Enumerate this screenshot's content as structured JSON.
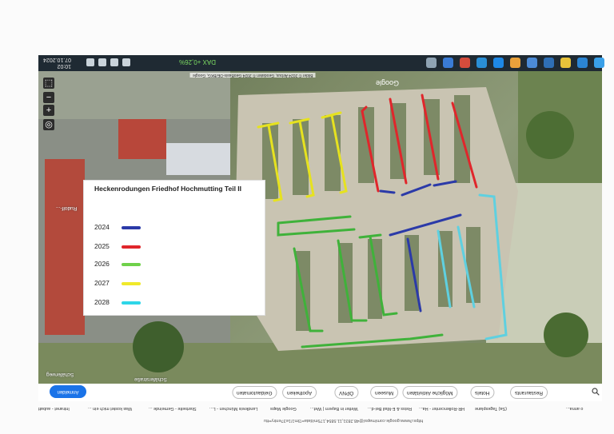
{
  "taskbar": {
    "time": "10:02",
    "date": "07.10.2024",
    "dax_label": "DAX",
    "dax_value": "+0,26%"
  },
  "map": {
    "google_mark": "Google",
    "attribution": "Bilder © 2024 Airbus, Geodaten © 2024 GeoBasis-DE/BKG, Google",
    "streets": {
      "top_left": "Schäferstraße",
      "bottom_left": "Schäferweg",
      "right": "Schaferstraße",
      "corner": "Rudolf-..."
    },
    "legend": {
      "title": "Heckenrodungen Friedhof Hochmutting Teil II",
      "items": [
        {
          "year": "2024",
          "color": "#2b3aa8"
        },
        {
          "year": "2025",
          "color": "#e0262b"
        },
        {
          "year": "2026",
          "color": "#6fd14a"
        },
        {
          "year": "2027",
          "color": "#f0e92a"
        },
        {
          "year": "2028",
          "color": "#2ed6e8"
        }
      ]
    },
    "hedge_colors": {
      "y2024": "#2b3aa8",
      "y2025": "#e0262b",
      "y2026": "#3fb23a",
      "y2027": "#e6e21f",
      "y2028": "#5fd0e0"
    }
  },
  "chips": {
    "navigate": "Anmelden",
    "items": [
      {
        "label": "Restaurants"
      },
      {
        "label": "Hotels"
      },
      {
        "label": "Mögliche Aktivitäten"
      },
      {
        "label": "Museen"
      },
      {
        "label": "ÖPNV"
      },
      {
        "label": "Apotheken"
      },
      {
        "label": "Geldautomaten"
      }
    ]
  },
  "bookmarks": [
    "Intranet - aubatt",
    "Was kostet mich ein ...",
    "Startseite - Gemeinde ...",
    "Landkreis München - L...",
    "Google Maps",
    "Wetter in Bayern | Wet...",
    "Reiss & E-Mail Bei-d...",
    "HR-Rollencenter - Ha...",
    "(Sa) Tagesplane",
    "o anna..."
  ],
  "url": "https://www.google.com/maps/@48.2831,11.5854,175m/data=!3m1!1e3?entry=ttu"
}
